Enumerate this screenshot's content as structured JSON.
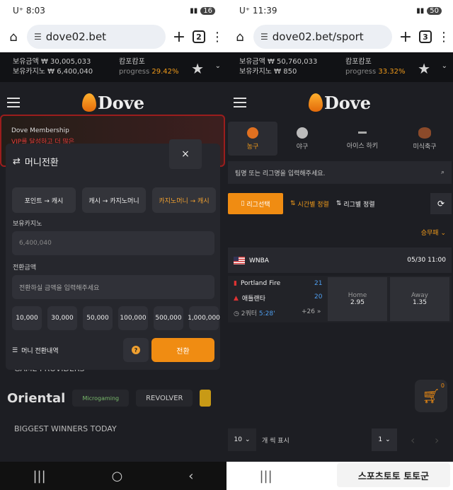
{
  "left": {
    "status": {
      "carrier": "U⁺ 8:03",
      "battery": "16"
    },
    "browser": {
      "url": "dove02.bet",
      "tab_count": "2"
    },
    "info": {
      "label1": "보유금액 ₩ 30,005,033",
      "label2": "보유카지노 ₩ 6,400,040",
      "campo": "캄포캄포",
      "progress": "progress",
      "pct": "29.42%"
    },
    "logo": "Dove",
    "banner": {
      "title": "Dove Membership",
      "sub": "VIP를 달성하고 더 많은"
    },
    "modal": {
      "title": "머니전환",
      "close": "×",
      "tabs": [
        "포인트 → 캐시",
        "캐시 → 카지노머니",
        "카지노머니 → 캐시"
      ],
      "holding_label": "보유카지노",
      "holding_value": "6,400,040",
      "convert_label": "전환금액",
      "convert_placeholder": "전환하실 금액을 입력해주세요",
      "amounts": [
        "10,000",
        "30,000",
        "50,000",
        "100,000",
        "500,000",
        "1,000,000"
      ],
      "history": "머니 전환내역",
      "help": "?",
      "submit": "전환"
    },
    "bg_text": {
      "providers": "GAME PROVIDERS",
      "winners": "BIGGEST WINNERS TODAY"
    },
    "providers": [
      "Oriental",
      "Microgaming",
      "REVOLVER"
    ]
  },
  "right": {
    "status": {
      "carrier": "U⁺ 11:39",
      "battery": "50"
    },
    "browser": {
      "url": "dove02.bet/sport",
      "tab_count": "3"
    },
    "info": {
      "label1": "보유금액 ₩ 50,760,033",
      "label2": "보유카지노 ₩ 850",
      "campo": "캄포캄포",
      "progress": "progress",
      "pct": "33.32%"
    },
    "logo": "Dove",
    "sports": [
      "농구",
      "야구",
      "아이스 하키",
      "미식축구"
    ],
    "search_placeholder": "팀명 또는 리그명을 입력해주세요.",
    "buttons": {
      "league": "리그선택",
      "time_sort": "시간별 정렬",
      "league_sort": "리그별 정렬"
    },
    "winlose": "승무패",
    "league": {
      "name": "WNBA",
      "time": "05/30 11:00"
    },
    "match": {
      "home_team": "Portland Fire",
      "home_score": "21",
      "away_team": "애틀랜타",
      "away_score": "20",
      "period": "2쿼터",
      "clock": "5:28'",
      "more": "+26 »",
      "home_label": "Home",
      "home_odds": "2.95",
      "away_label": "Away",
      "away_odds": "1.35"
    },
    "cart_count": "0",
    "pager": {
      "per_page": "10",
      "label": "개 씩 표시",
      "page": "1"
    },
    "watermark": "스포츠토토 토토군"
  }
}
